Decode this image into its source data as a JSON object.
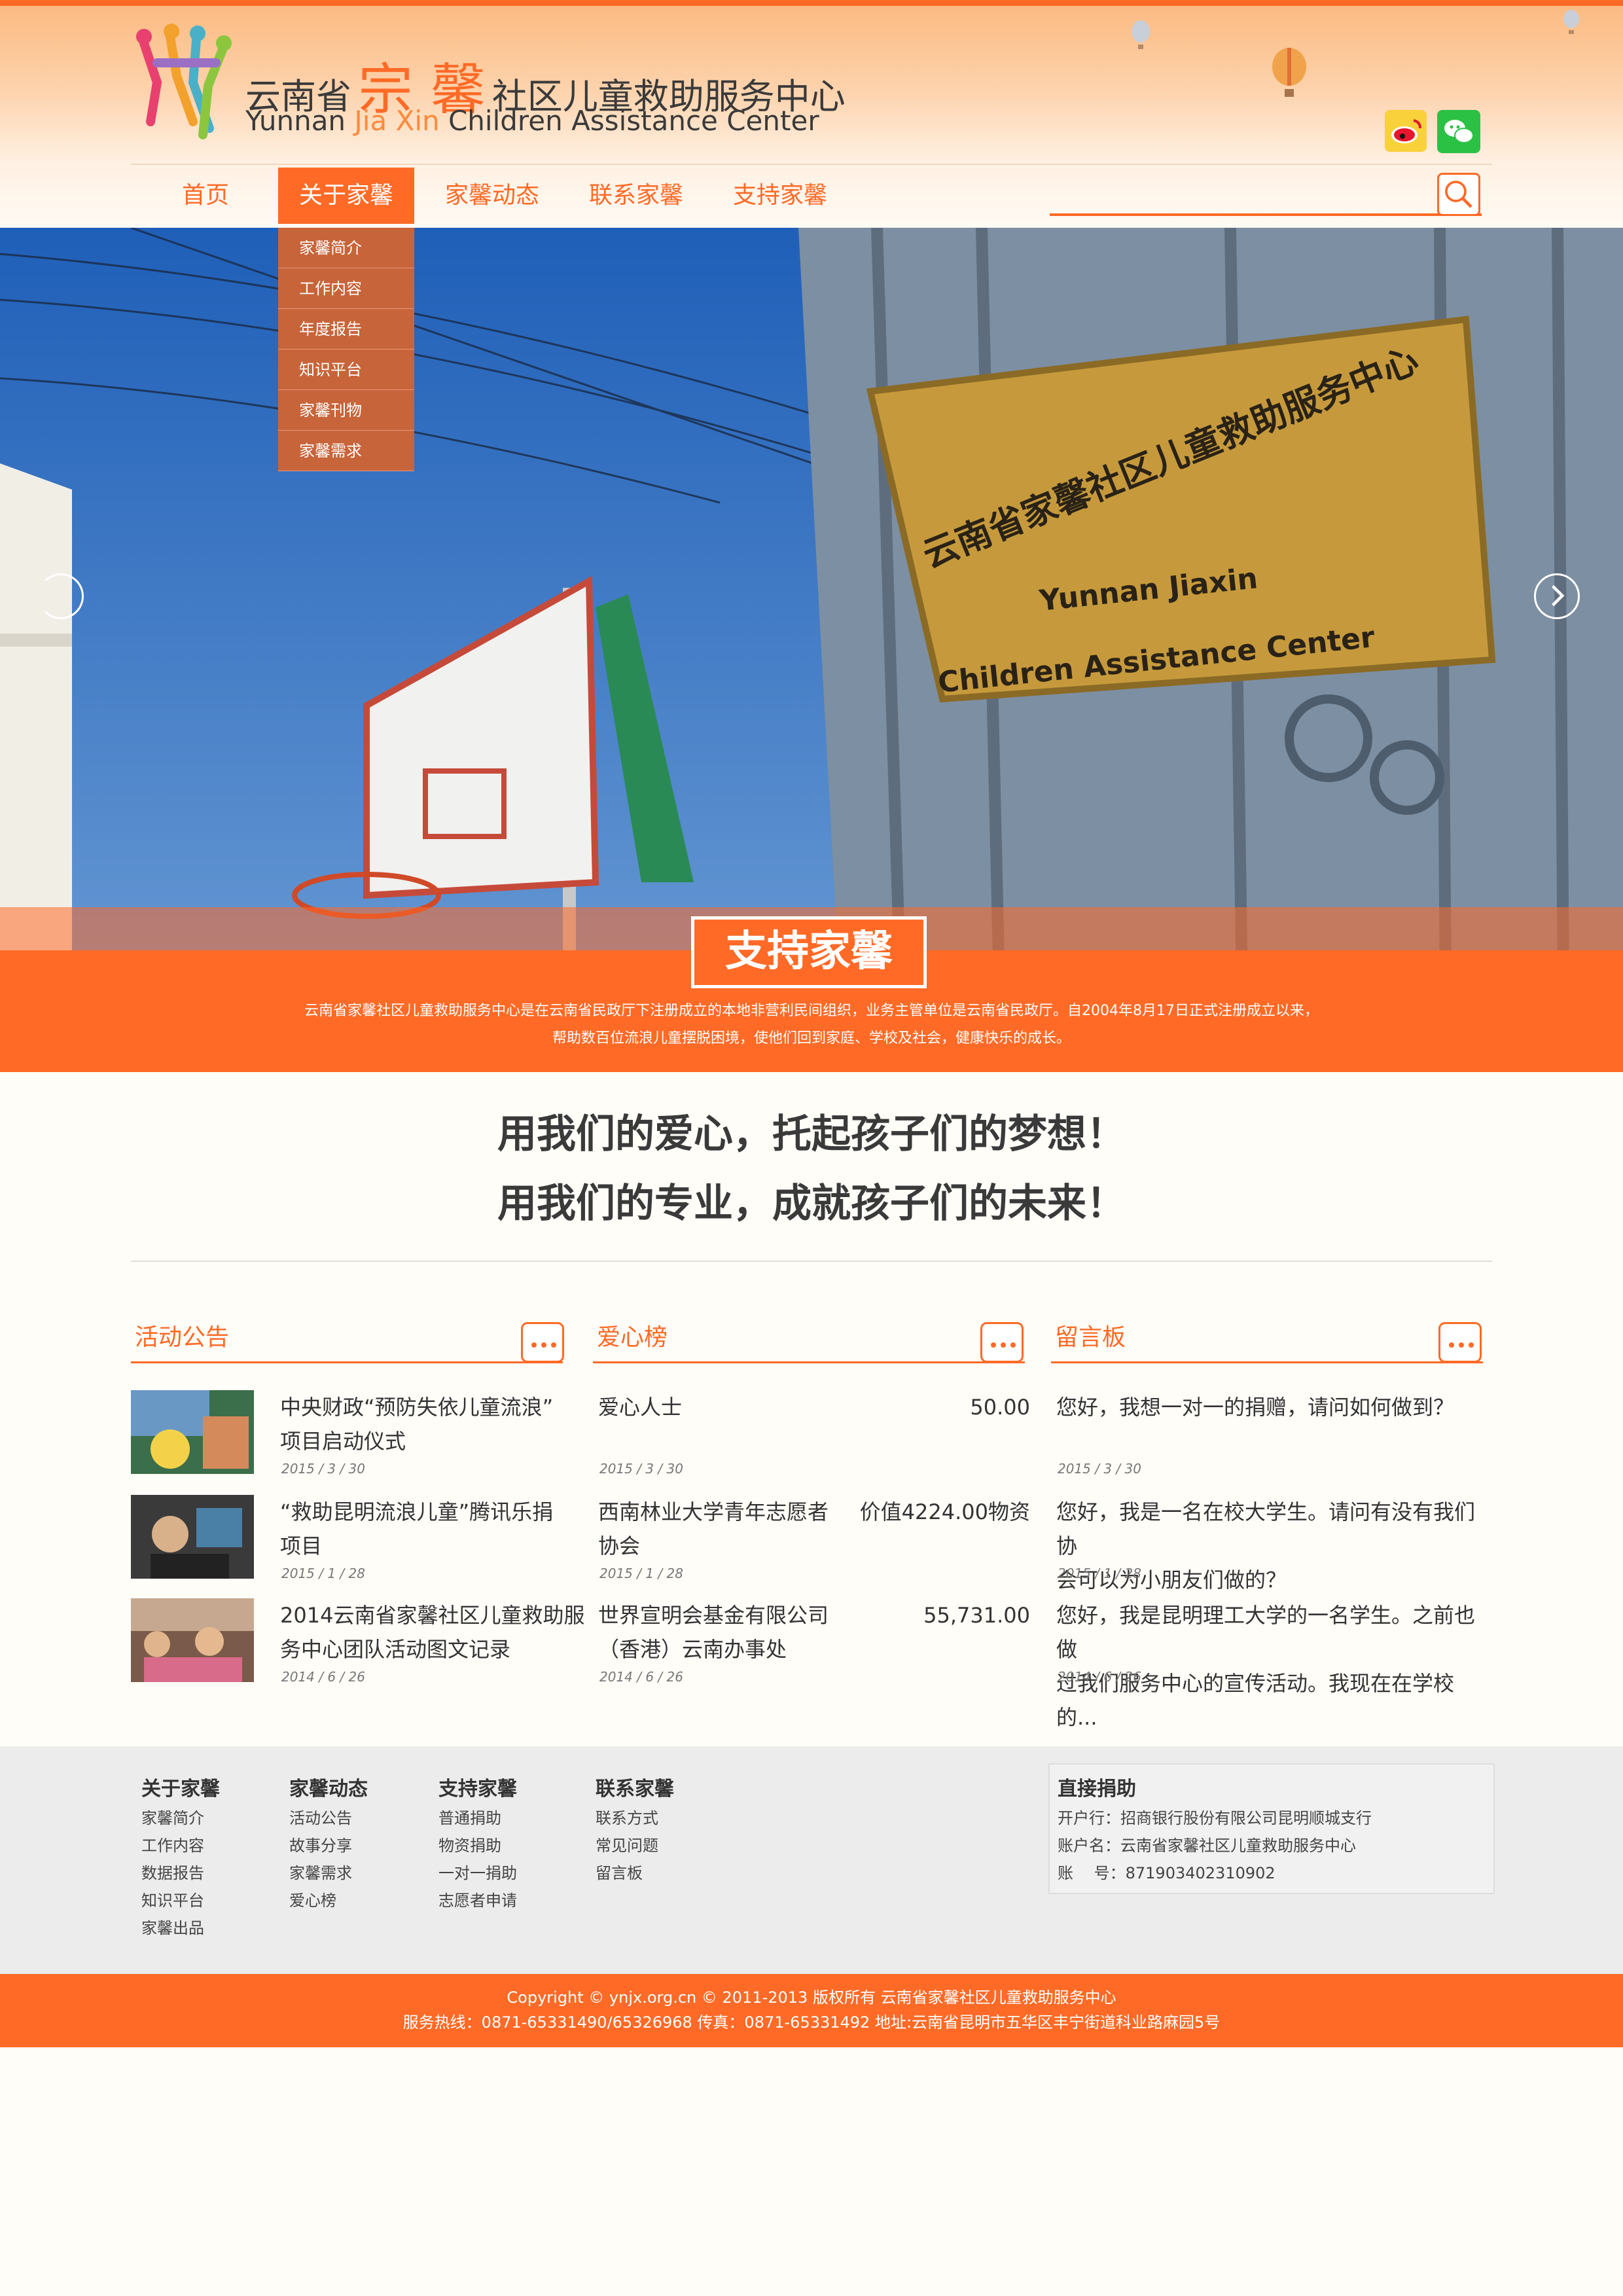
{
  "header": {
    "brand_cn_pre": "云南省",
    "brand_cn_big": "宗 馨",
    "brand_cn_post": "社区儿童救助服务中心",
    "brand_en_pre": "Yunnan ",
    "brand_en_hl": "Jia Xin",
    "brand_en_post": " Children Assistance Center"
  },
  "nav": {
    "items": [
      "首页",
      "关于家馨",
      "家馨动态",
      "联系家馨",
      "支持家馨"
    ],
    "active": "关于家馨",
    "search_placeholder": ""
  },
  "dropdown": [
    "家馨简介",
    "工作内容",
    "年度报告",
    "知识平台",
    "家馨刊物",
    "家馨需求"
  ],
  "banner": {
    "plaque_cn": "云南省家馨社区儿童救助服务中心",
    "plaque_en_1": "Yunnan Jiaxin",
    "plaque_en_2": "Children Assistance Center",
    "cta": "支持家馨",
    "desc_1": "云南省家馨社区儿童救助服务中心是在云南省民政厅下注册成立的本地非营利民间组织，业务主管单位是云南省民政厅。自2004年8月17日正式注册成立以来，",
    "desc_2": "帮助数百位流浪儿童摆脱困境，使他们回到家庭、学校及社会，健康快乐的成长。"
  },
  "slogans": [
    "用我们的爱心，托起孩子们的梦想！",
    "用我们的专业，成就孩子们的未来！"
  ],
  "news": {
    "title": "活动公告",
    "items": [
      {
        "title_1": "中央财政“预防失依儿童流浪”",
        "title_2": "项目启动仪式",
        "date": "2015 / 3 / 30"
      },
      {
        "title_1": "“救助昆明流浪儿童”腾讯乐捐",
        "title_2": "项目",
        "date": "2015 / 1 / 28"
      },
      {
        "title_1": "2014云南省家馨社区儿童救助服",
        "title_2": "务中心团队活动图文记录",
        "date": "2014 / 6 / 26"
      }
    ]
  },
  "donors": {
    "title": "爱心榜",
    "items": [
      {
        "name_1": "爱心人士",
        "name_2": "",
        "amount": "50.00",
        "date": "2015 / 3 / 30"
      },
      {
        "name_1": "西南林业大学青年志愿者",
        "name_2": "协会",
        "amount": "价值4224.00物资",
        "date": "2015 / 1 / 28"
      },
      {
        "name_1": "世界宣明会基金有限公司",
        "name_2": "（香港）云南办事处",
        "amount": "55,731.00",
        "date": "2014 / 6 / 26"
      }
    ]
  },
  "messages": {
    "title": "留言板",
    "items": [
      {
        "text_1": "您好，我想一对一的捐赠，请问如何做到？",
        "text_2": "",
        "date": "2015 / 3 / 30"
      },
      {
        "text_1": "您好，我是一名在校大学生。请问有没有我们协",
        "text_2": "会可以为小朋友们做的？",
        "date": "2015 / 1 / 28"
      },
      {
        "text_1": "您好，我是昆明理工大学的一名学生。之前也做",
        "text_2": "过我们服务中心的宣传活动。我现在在学校的...",
        "date": "2014 / 6 / 26"
      }
    ]
  },
  "footer": {
    "columns": [
      {
        "title": "关于家馨",
        "links": [
          "家馨简介",
          "工作内容",
          "数据报告",
          "知识平台",
          "家馨出品"
        ]
      },
      {
        "title": "家馨动态",
        "links": [
          "活动公告",
          "故事分享",
          "家馨需求",
          "爱心榜"
        ]
      },
      {
        "title": "支持家馨",
        "links": [
          "普通捐助",
          "物资捐助",
          "一对一捐助",
          "志愿者申请"
        ]
      },
      {
        "title": "联系家馨",
        "links": [
          "联系方式",
          "常见问题",
          "留言板"
        ]
      }
    ],
    "donate": {
      "title": "直接捐助",
      "bank": "开户行：招商银行股份有限公司昆明顺城支行",
      "account_name": "账户名：云南省家馨社区儿童救助服务中心",
      "account_no": "账　 号：871903402310902"
    },
    "copyright_1": "Copyright © ynjx.org.cn © 2011-2013 版权所有 云南省家馨社区儿童救助服务中心",
    "copyright_2": "服务热线：0871-65331490/65326968 传真：0871-65331492 地址:云南省昆明市五华区丰宁街道科业路麻园5号"
  },
  "colors": {
    "accent": "#ff6a26",
    "sky": "#2f6fc4",
    "wall": "#7a8fa4",
    "plaque": "#c69a3c"
  }
}
